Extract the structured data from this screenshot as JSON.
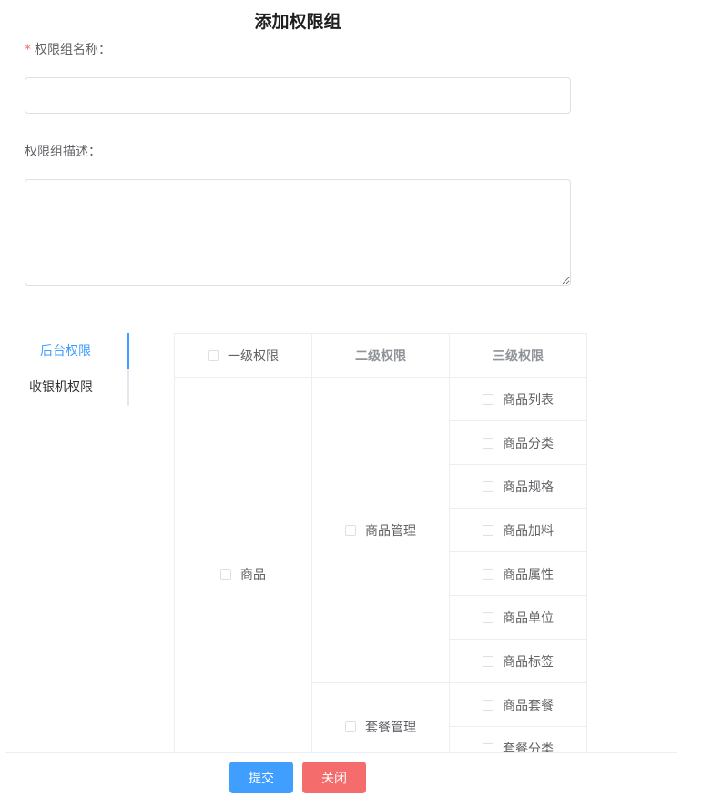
{
  "dialog": {
    "title": "添加权限组"
  },
  "form": {
    "name_required_mark": "*",
    "name_label": "权限组名称：",
    "name_value": "",
    "desc_label": "权限组描述：",
    "desc_value": ""
  },
  "tabs": [
    {
      "label": "后台权限",
      "active": true
    },
    {
      "label": "收银机权限",
      "active": false
    }
  ],
  "table": {
    "headers": [
      "一级权限",
      "二级权限",
      "三级权限"
    ],
    "level1": [
      {
        "label": "商品",
        "checked": false
      }
    ],
    "level2": [
      {
        "label": "商品管理",
        "checked": false
      },
      {
        "label": "套餐管理",
        "checked": false
      }
    ],
    "level3": [
      {
        "label": "商品列表",
        "checked": false
      },
      {
        "label": "商品分类",
        "checked": false
      },
      {
        "label": "商品规格",
        "checked": false
      },
      {
        "label": "商品加料",
        "checked": false
      },
      {
        "label": "商品属性",
        "checked": false
      },
      {
        "label": "商品单位",
        "checked": false
      },
      {
        "label": "商品标签",
        "checked": false
      },
      {
        "label": "商品套餐",
        "checked": false
      },
      {
        "label": "套餐分类",
        "checked": false
      }
    ]
  },
  "footer": {
    "submit_label": "提交",
    "close_label": "关闭"
  },
  "colors": {
    "primary": "#409eff",
    "danger": "#f56c6c",
    "border": "#dcdfe6"
  }
}
